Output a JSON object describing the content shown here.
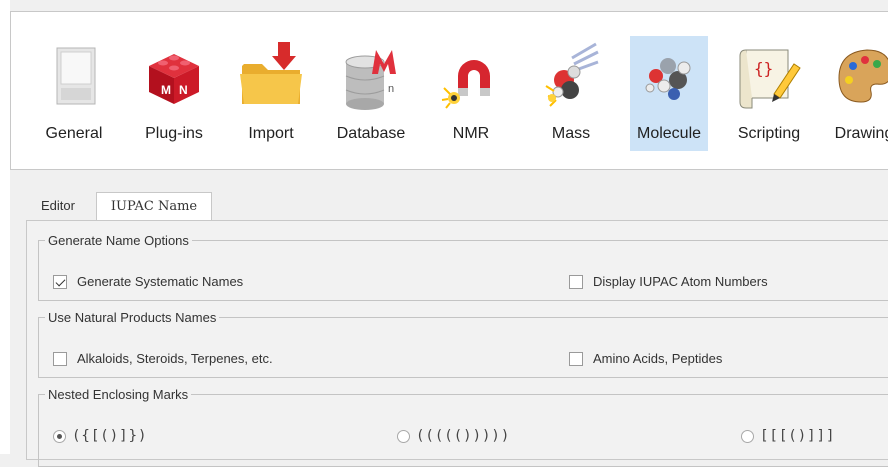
{
  "categories": [
    {
      "label": "General",
      "icon": "general-icon",
      "selected": false
    },
    {
      "label": "Plug-ins",
      "icon": "plugins-icon",
      "selected": false
    },
    {
      "label": "Import",
      "icon": "import-folder-icon",
      "selected": false
    },
    {
      "label": "Database",
      "icon": "database-icon",
      "selected": false
    },
    {
      "label": "NMR",
      "icon": "nmr-magnet-icon",
      "selected": false
    },
    {
      "label": "Mass",
      "icon": "mass-icon",
      "selected": false
    },
    {
      "label": "Molecule",
      "icon": "molecule-icon",
      "selected": true
    },
    {
      "label": "Scripting",
      "icon": "scripting-icon",
      "selected": false
    },
    {
      "label": "Drawing",
      "icon": "drawing-palette-icon",
      "selected": false
    }
  ],
  "tabs": [
    {
      "label": "Editor",
      "active": false
    },
    {
      "label": "IUPAC Name",
      "active": true
    }
  ],
  "groups": {
    "generate": {
      "title": "Generate Name Options",
      "generate_systematic": {
        "label": "Generate Systematic Names",
        "checked": true
      },
      "display_atom_numbers": {
        "label": "Display IUPAC Atom Numbers",
        "checked": false
      }
    },
    "natural": {
      "title": "Use Natural Products Names",
      "alkaloids": {
        "label": "Alkaloids, Steroids, Terpenes, etc.",
        "checked": false
      },
      "amino_acids": {
        "label": "Amino Acids, Peptides",
        "checked": false
      }
    },
    "nested": {
      "title": "Nested Enclosing Marks",
      "options": [
        {
          "label": "({[()]})",
          "selected": true
        },
        {
          "label": "((((()))))",
          "selected": false
        },
        {
          "label": "[[[()]]]",
          "selected": false
        }
      ]
    }
  }
}
